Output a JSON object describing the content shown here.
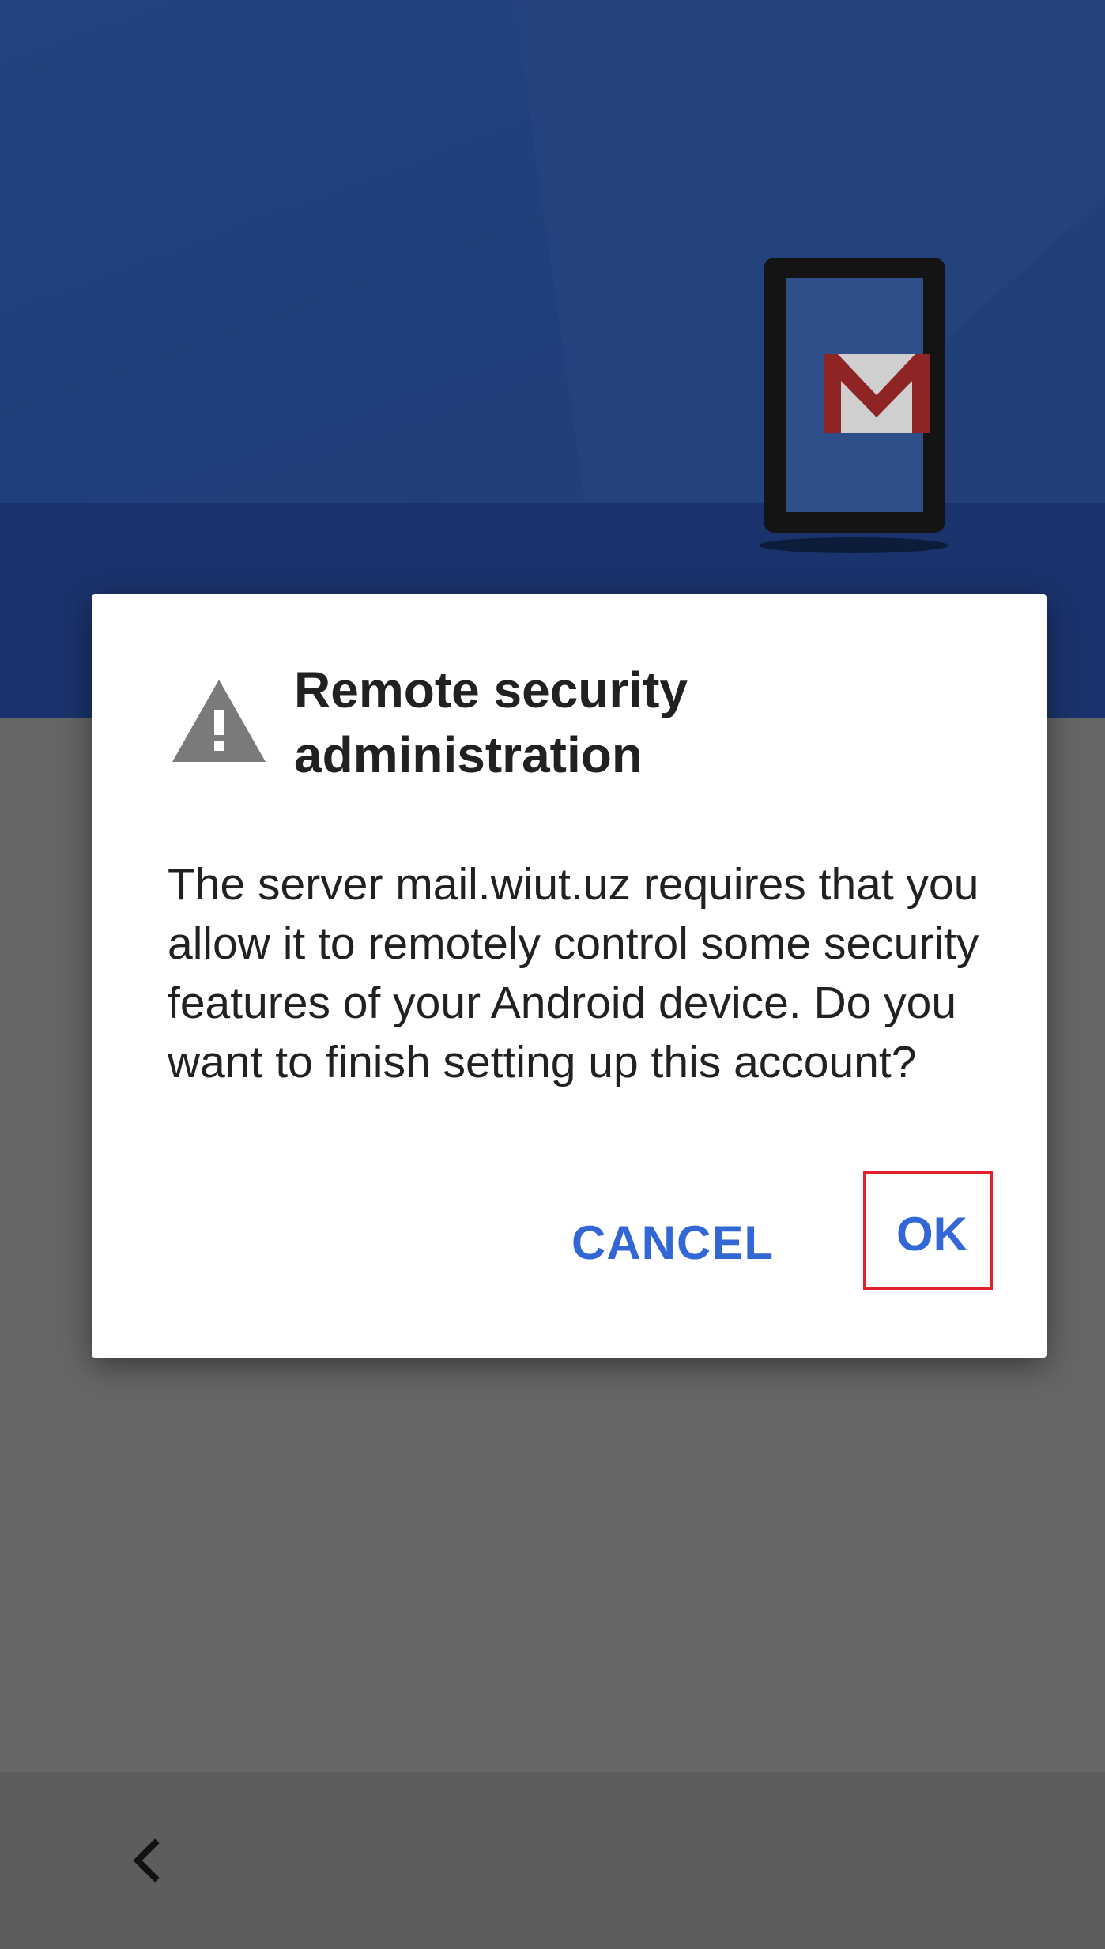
{
  "dialog": {
    "title": "Remote security administration",
    "message": "The server mail.wiut.uz requires that you allow it to remotely control some security features of your Android device. Do you want to finish setting up this account?",
    "cancel_label": "CANCEL",
    "ok_label": "OK"
  },
  "icons": {
    "warning": "warning-icon",
    "back": "back-icon",
    "mail": "gmail-icon",
    "phone": "phone-illustration"
  },
  "colors": {
    "accent": "#3367d6",
    "highlight": "#e2202c",
    "header": "#1e3c7a"
  }
}
